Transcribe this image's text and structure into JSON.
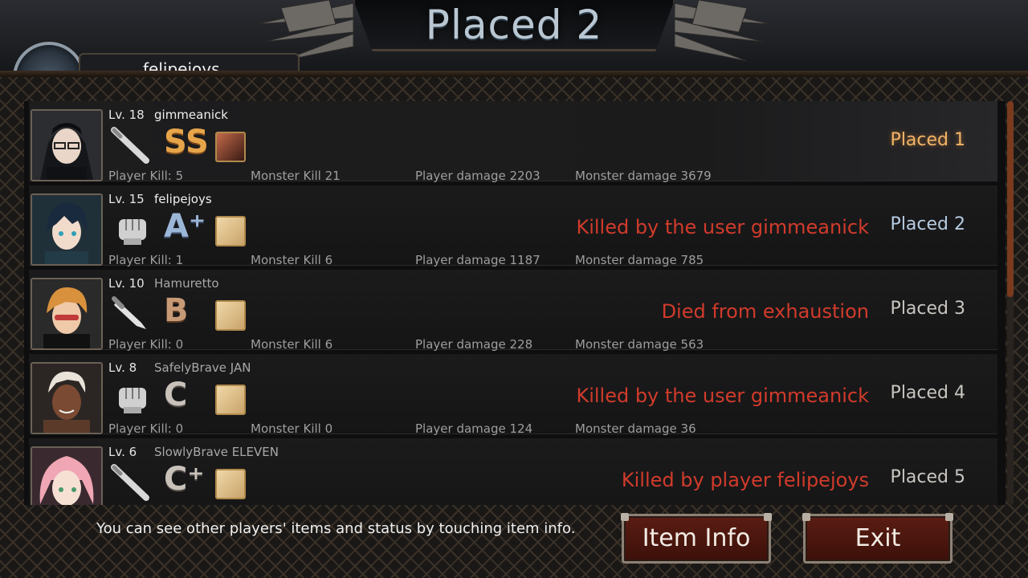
{
  "header": {
    "title": "Placed 2",
    "player_name": "felipejoys"
  },
  "rows": [
    {
      "level": "Lv. 18",
      "name": "gimmeanick",
      "weapon": "baseball-bat-icon",
      "grade": "SS",
      "cause": "",
      "placed": "Placed 1",
      "player_kill": "Player Kill: 5",
      "monster_kill": "Monster Kill 21",
      "player_damage": "Player damage 2203",
      "monster_damage": "Monster damage 3679"
    },
    {
      "level": "Lv. 15",
      "name": "felipejoys",
      "weapon": "fist-icon",
      "grade": "A⁺",
      "cause": "Killed by the user gimmeanick",
      "placed": "Placed 2",
      "player_kill": "Player Kill: 1",
      "monster_kill": "Monster Kill 6",
      "player_damage": "Player damage 1187",
      "monster_damage": "Monster damage 785"
    },
    {
      "level": "Lv. 10",
      "name": "Hamuretto",
      "weapon": "knife-icon",
      "grade": "B",
      "cause": "Died from exhaustion",
      "placed": "Placed 3",
      "player_kill": "Player Kill: 0",
      "monster_kill": "Monster Kill 6",
      "player_damage": "Player damage 228",
      "monster_damage": "Monster damage 563"
    },
    {
      "level": "Lv. 8",
      "name": "SafelyBrave JAN",
      "weapon": "fist-icon",
      "grade": "C",
      "cause": "Killed by the user gimmeanick",
      "placed": "Placed 4",
      "player_kill": "Player Kill: 0",
      "monster_kill": "Monster Kill 0",
      "player_damage": "Player damage 124",
      "monster_damage": "Monster damage 36"
    },
    {
      "level": "Lv. 6",
      "name": "SlowlyBrave ELEVEN",
      "weapon": "baseball-bat-icon",
      "grade": "C⁺",
      "cause": "Killed by player felipejoys",
      "placed": "Placed 5",
      "player_kill": "",
      "monster_kill": "",
      "player_damage": "",
      "monster_damage": ""
    }
  ],
  "footer": {
    "hint": "You can see other players' items and status by touching item info.",
    "item_info_label": "Item Info",
    "exit_label": "Exit"
  },
  "colors": {
    "cause_red": "#d13b2b",
    "placed_gold": "#f2b468",
    "button_red": "#5a1d14"
  }
}
